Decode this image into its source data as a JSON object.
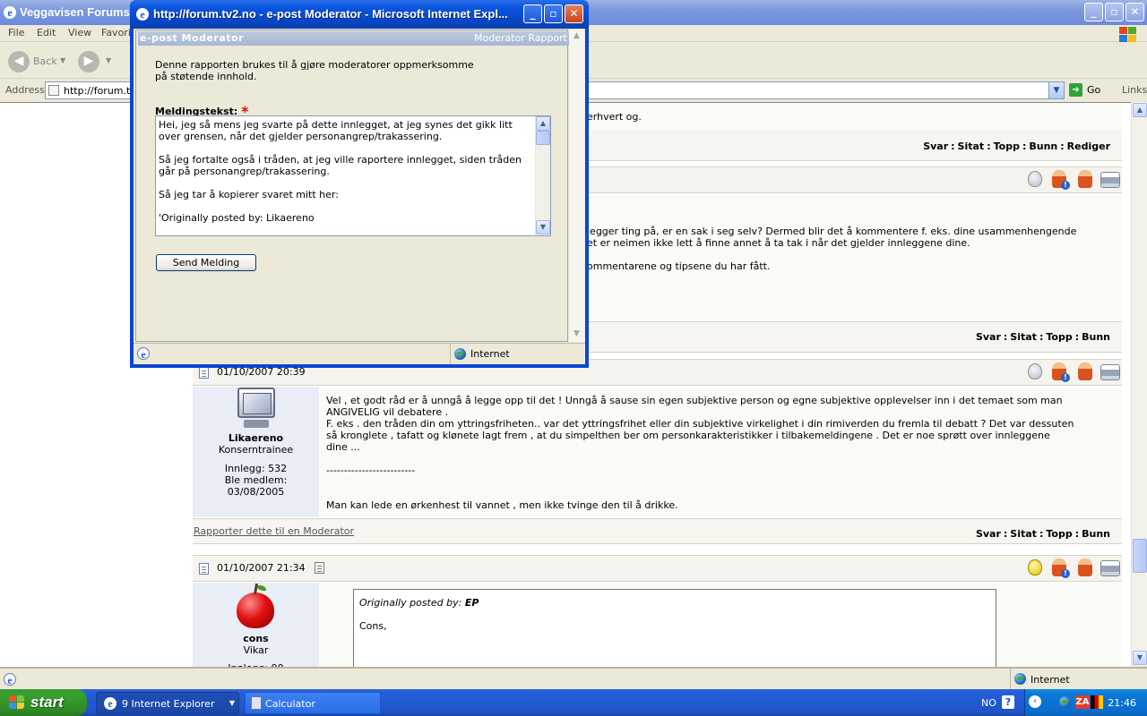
{
  "main_window": {
    "title": "Veggavisen Forums",
    "menu": [
      "File",
      "Edit",
      "View",
      "Favorit"
    ],
    "back_label": "Back",
    "address_label": "Address",
    "address_value": "http://forum.tv",
    "go_label": "Go",
    "links_label": "Links",
    "status_zone": "Internet"
  },
  "forum": {
    "snippet_top": "erhvert og.",
    "actions_edit": [
      "Svar",
      "Sitat",
      "Topp",
      "Bunn",
      "Rediger"
    ],
    "actions": [
      "Svar",
      "Sitat",
      "Topp",
      "Bunn"
    ],
    "post1_lines": [
      "legger ting på, er en sak i seg selv? Dermed blir det å kommentere f. eks. dine usammenhengende",
      "et er neimen ikke lett å finne annet å ta tak i når det gjelder innleggene dine.",
      "",
      "ommentarene og tipsene du har fått."
    ],
    "post2": {
      "date": "01/10/2007 20:39",
      "username": "Likaereno",
      "rank": "Konserntrainee",
      "posts": "Innlegg: 532",
      "member_label": "Ble medlem:",
      "member_date": "03/08/2005",
      "body": "Vel , et godt råd er å unngå å legge opp til det ! Unngå å sause sin egen subjektive person og egne subjektive opplevelser inn i det temaet som man\nANGIVELIG vil debatere .\nF. eks . den tråden din om yttringsfriheten.. var det yttringsfrihet eller din subjektive virkelighet i din rimiverden du fremla til debatt ? Det var dessuten\nså kronglete , tafatt og klønete lagt frem , at du simpelthen ber om personkarakteristikker i tilbakemeldingene . Det er noe sprøtt over innleggene\ndine ...\n\n-------------------------\n\n\nMan kan lede en ørkenhest til vannet , men ikke tvinge den til å drikke.",
      "report_link": "Rapporter dette til en Moderator"
    },
    "post3": {
      "date": "01/10/2007 21:34",
      "username": "cons",
      "rank": "Vikar",
      "posts": "Innlegg: 90",
      "quote_header": "Originally posted by:",
      "quote_author": "EP",
      "quote_text": "Cons,"
    }
  },
  "popup": {
    "title": "http://forum.tv2.no - e-post Moderator - Microsoft Internet Expl...",
    "header_left": "e-post Moderator",
    "header_right": "Moderator Rapport",
    "description": "Denne rapporten brukes til å gjøre moderatorer oppmerksomme\npå støtende innhold.",
    "message_label": "Meldingstekst:",
    "required_mark": "*",
    "message_text": "Hei, jeg så mens jeg svarte på dette innlegget, at jeg synes det gikk litt over grensen, når det gjelder personangrep/trakassering.\n\nSå jeg fortalte også i tråden, at jeg ville raportere innlegget, siden tråden går på personangrep/trakassering.\n\nSå jeg tar å kopierer svaret mitt her:\n\n'Originally posted by: Likaereno",
    "send_label": "Send Melding",
    "status_zone": "Internet"
  },
  "taskbar": {
    "start_label": "start",
    "tasks": [
      "9 Internet Explorer",
      "Calculator"
    ],
    "language": "NO",
    "clock": "21:46"
  },
  "colors": {
    "title_blue": "#0a55e0",
    "post_header": "#f4f3ed",
    "user_panel": "#e8edf6",
    "start_green": "#37a02d"
  }
}
